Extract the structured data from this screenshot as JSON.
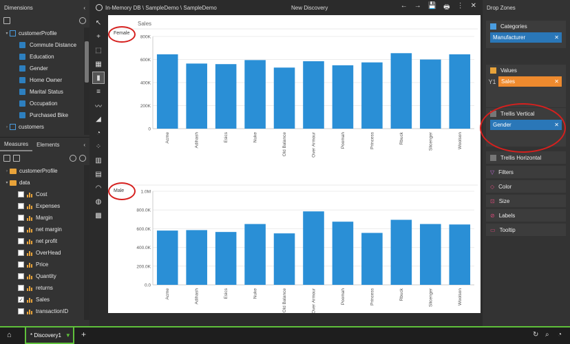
{
  "left_panel": {
    "dimensions_title": "Dimensions",
    "collapse_label": "‹",
    "dim_tree": [
      {
        "label": "customerProfile",
        "level": 0,
        "type": "hierarchy",
        "expanded": true
      },
      {
        "label": "Commute Distance",
        "level": 1,
        "type": "field"
      },
      {
        "label": "Education",
        "level": 1,
        "type": "field"
      },
      {
        "label": "Gender",
        "level": 1,
        "type": "field"
      },
      {
        "label": "Home Owner",
        "level": 1,
        "type": "field"
      },
      {
        "label": "Marital Status",
        "level": 1,
        "type": "field"
      },
      {
        "label": "Occupation",
        "level": 1,
        "type": "field"
      },
      {
        "label": "Purchased Bike",
        "level": 1,
        "type": "field"
      },
      {
        "label": "customers",
        "level": 0,
        "type": "hierarchy",
        "expanded": false
      }
    ],
    "tabs": {
      "measures": "Measures",
      "elements": "Elements"
    },
    "meas_tree": [
      {
        "label": "customerProfile",
        "level": 0,
        "type": "folder",
        "expanded": false
      },
      {
        "label": "data",
        "level": 0,
        "type": "folder",
        "expanded": true
      },
      {
        "label": "Cost",
        "level": 1,
        "checked": false
      },
      {
        "label": "Expenses",
        "level": 1,
        "checked": false
      },
      {
        "label": "Margin",
        "level": 1,
        "checked": false
      },
      {
        "label": "net margin",
        "level": 1,
        "checked": false
      },
      {
        "label": "net profit",
        "level": 1,
        "checked": false
      },
      {
        "label": "OverHead",
        "level": 1,
        "checked": false
      },
      {
        "label": "Price",
        "level": 1,
        "checked": false
      },
      {
        "label": "Quantity",
        "level": 1,
        "checked": false
      },
      {
        "label": "returns",
        "level": 1,
        "checked": false
      },
      {
        "label": "Sales",
        "level": 1,
        "checked": true
      },
      {
        "label": "transactionID",
        "level": 1,
        "checked": false
      }
    ]
  },
  "titlebar": {
    "path": "In-Memory DB \\ SampleDemo \\ SampleDemo",
    "doc_title": "New Discovery",
    "actions": [
      "←",
      "→",
      "💾",
      "🖶",
      "⋮",
      "✕"
    ]
  },
  "right_panel": {
    "title": "Drop Zones",
    "categories": {
      "title": "Categories",
      "pill": "Manufacturer"
    },
    "values": {
      "title": "Values",
      "axis_label": "Y1",
      "pill": "Sales"
    },
    "trellis_vertical": {
      "title": "Trellis Vertical",
      "pill": "Gender"
    },
    "trellis_horizontal": "Trellis Horizontal",
    "filters": "Filters",
    "color": "Color",
    "size": "Size",
    "labels": "Labels",
    "tooltip": "Tooltip"
  },
  "bottom": {
    "tab_label": "* Discovery1",
    "add_label": "+"
  },
  "colors": {
    "bar": "#2a8fd6",
    "accent_green": "#5fc13b",
    "annotation_red": "#d6201e"
  },
  "chart_data": [
    {
      "type": "bar",
      "title": "Sales",
      "panel_label": "Female",
      "categories": [
        "Acme",
        "Adihash",
        "Esics",
        "Nuke",
        "Old Balance",
        "Over Armour",
        "Poomah",
        "Princess",
        "Rbuck",
        "Slicenger",
        "Woolson"
      ],
      "values": [
        645000,
        565000,
        560000,
        595000,
        530000,
        585000,
        550000,
        575000,
        655000,
        600000,
        645000
      ],
      "ylim": [
        0,
        800000
      ],
      "yticks": [
        "0",
        "200K",
        "400K",
        "600K",
        "800K"
      ],
      "grid": true
    },
    {
      "type": "bar",
      "panel_label": "Male",
      "categories": [
        "Acme",
        "Adihash",
        "Esics",
        "Nuke",
        "Old Balance",
        "Over Armour",
        "Poomah",
        "Princess",
        "Rbuck",
        "Slicenger",
        "Woolson"
      ],
      "values": [
        580000,
        585000,
        565000,
        650000,
        550000,
        785000,
        675000,
        555000,
        695000,
        650000,
        645000
      ],
      "ylim": [
        0,
        1000000
      ],
      "yticks": [
        "0.0",
        "200.0K",
        "400.0K",
        "600.0K",
        "800.0K",
        "1.0M"
      ],
      "grid": true
    }
  ]
}
